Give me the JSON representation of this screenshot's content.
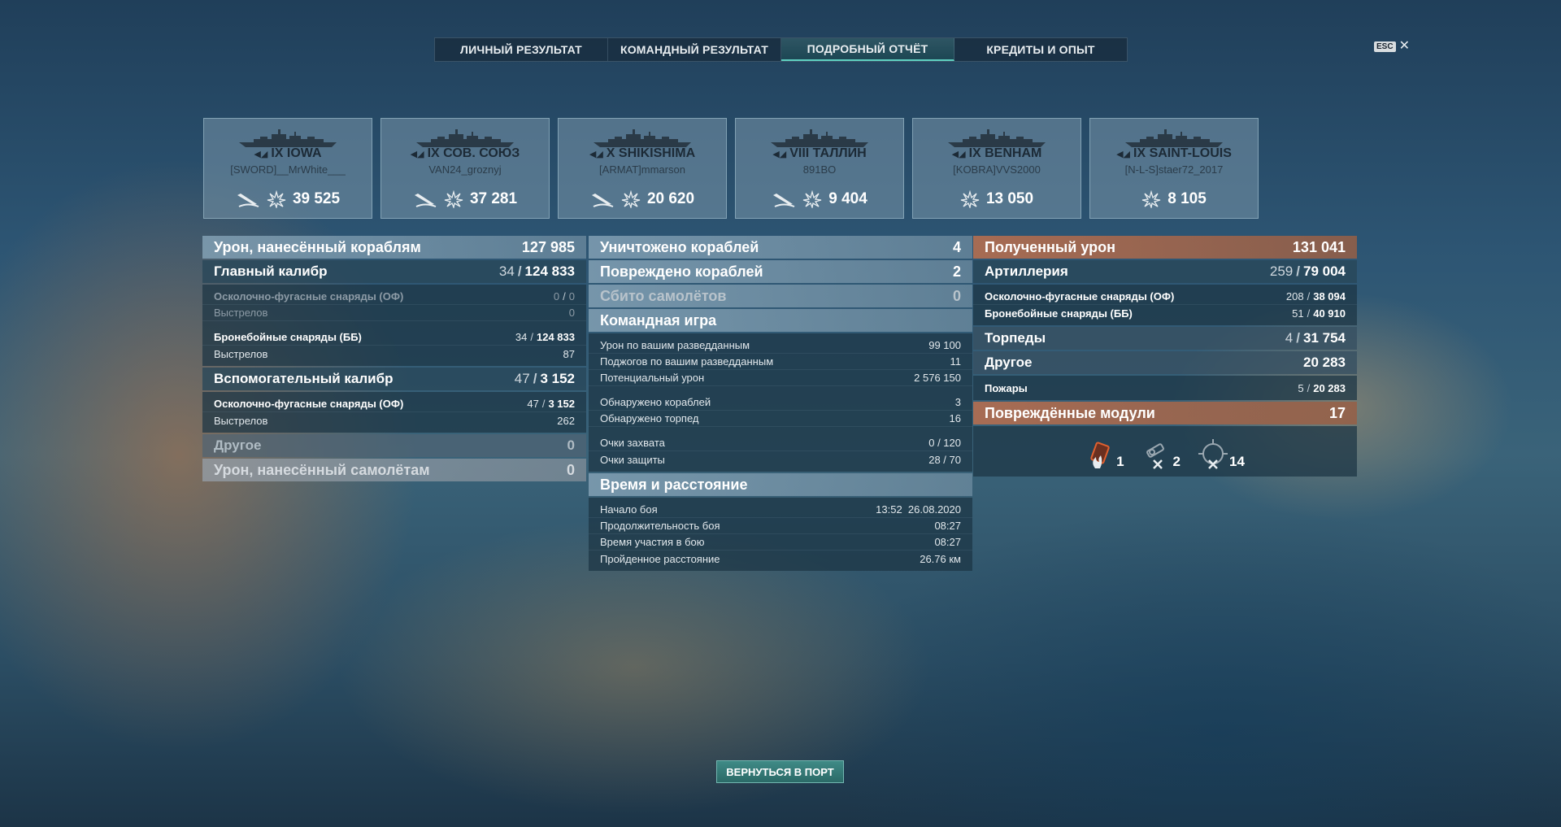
{
  "tabs": [
    {
      "label": "ЛИЧНЫЙ РЕЗУЛЬТАТ",
      "active": false
    },
    {
      "label": "КОМАНДНЫЙ РЕЗУЛЬТАТ",
      "active": false
    },
    {
      "label": "ПОДРОБНЫЙ ОТЧЁТ",
      "active": true
    },
    {
      "label": "КРЕДИТЫ И ОПЫТ",
      "active": false
    }
  ],
  "esc": {
    "key": "ESC",
    "close": "✕"
  },
  "ships": [
    {
      "tier_name": "IX IOWA",
      "class_icon": "battleship-icon",
      "player": "[SWORD]__MrWhite___",
      "torpedoed": true,
      "damage": "39 525"
    },
    {
      "tier_name": "IX СОВ. СОЮЗ",
      "class_icon": "battleship-icon",
      "player": "VAN24_groznyj",
      "torpedoed": true,
      "damage": "37 281"
    },
    {
      "tier_name": "X SHIKISHIMA",
      "class_icon": "battleship-icon",
      "player": "[ARMAT]mmarson",
      "torpedoed": true,
      "damage": "20 620"
    },
    {
      "tier_name": "VIII ТАЛЛИН",
      "class_icon": "cruiser-icon",
      "player": "891BO",
      "torpedoed": true,
      "damage": "9 404"
    },
    {
      "tier_name": "IX BENHAM",
      "class_icon": "destroyer-icon",
      "player": "[KOBRA]VVS2000",
      "torpedoed": false,
      "damage": "13 050"
    },
    {
      "tier_name": "IX SAINT-LOUIS",
      "class_icon": "cruiser-icon",
      "player": "[N-L-S]staer72_2017",
      "torpedoed": false,
      "damage": "8 105"
    }
  ],
  "dealt": {
    "title": "Урон, нанесённый кораблям",
    "total": "127 985",
    "main_battery": {
      "label": "Главный калибр",
      "hits": "34",
      "dmg": "124 833"
    },
    "main_he": {
      "label": "Осколочно-фугасные снаряды (ОФ)",
      "hits": "0",
      "dmg": "0"
    },
    "main_he_shots": {
      "label": "Выстрелов",
      "value": "0"
    },
    "main_ap": {
      "label": "Бронебойные снаряды (ББ)",
      "hits": "34",
      "dmg": "124 833"
    },
    "main_ap_shots": {
      "label": "Выстрелов",
      "value": "87"
    },
    "secondary": {
      "label": "Вспомогательный калибр",
      "hits": "47",
      "dmg": "3 152"
    },
    "sec_he": {
      "label": "Осколочно-фугасные снаряды (ОФ)",
      "hits": "47",
      "dmg": "3 152"
    },
    "sec_shots": {
      "label": "Выстрелов",
      "value": "262"
    },
    "other": {
      "label": "Другое",
      "value": "0"
    },
    "planes": {
      "label": "Урон, нанесённый самолётам",
      "value": "0"
    }
  },
  "team": {
    "destroyed": {
      "label": "Уничтожено кораблей",
      "value": "4"
    },
    "damaged": {
      "label": "Повреждено кораблей",
      "value": "2"
    },
    "planes_shot": {
      "label": "Сбито самолётов",
      "value": "0"
    },
    "team_title": "Командная игра",
    "spotting_dmg": {
      "label": "Урон по вашим разведданным",
      "value": "99 100"
    },
    "spotting_fires": {
      "label": "Поджогов по вашим разведданным",
      "value": "11"
    },
    "potential": {
      "label": "Потенциальный урон",
      "value": "2 576 150"
    },
    "ships_spotted": {
      "label": "Обнаружено кораблей",
      "value": "3"
    },
    "torps_spotted": {
      "label": "Обнаружено торпед",
      "value": "16"
    },
    "capture": {
      "label": "Очки захвата",
      "value": "0 / 120"
    },
    "defense": {
      "label": "Очки защиты",
      "value": "28 / 70"
    },
    "time_title": "Время и расстояние",
    "start": {
      "label": "Начало боя",
      "value": "13:52  26.08.2020"
    },
    "duration": {
      "label": "Продолжительность боя",
      "value": "08:27"
    },
    "participation": {
      "label": "Время участия в бою",
      "value": "08:27"
    },
    "distance": {
      "label": "Пройденное расстояние",
      "value": "26.76 км"
    }
  },
  "received": {
    "title": "Полученный урон",
    "total": "131 041",
    "artillery": {
      "label": "Артиллерия",
      "hits": "259",
      "dmg": "79 004"
    },
    "he": {
      "label": "Осколочно-фугасные снаряды (ОФ)",
      "hits": "208",
      "dmg": "38 094"
    },
    "ap": {
      "label": "Бронебойные снаряды (ББ)",
      "hits": "51",
      "dmg": "40 910"
    },
    "torpedoes": {
      "label": "Торпеды",
      "hits": "4",
      "dmg": "31 754"
    },
    "other": {
      "label": "Другое",
      "value": "20 283"
    },
    "fires": {
      "label": "Пожары",
      "hits": "5",
      "dmg": "20 283"
    },
    "modules": {
      "label": "Повреждённые модули",
      "total": "17",
      "items": [
        {
          "icon": "fire-module-icon",
          "count": "1"
        },
        {
          "icon": "torpedo-tube-icon",
          "count": "2"
        },
        {
          "icon": "gun-turret-icon",
          "count": "14"
        }
      ]
    }
  },
  "return_button": "ВЕРНУТЬСЯ В ПОРТ"
}
